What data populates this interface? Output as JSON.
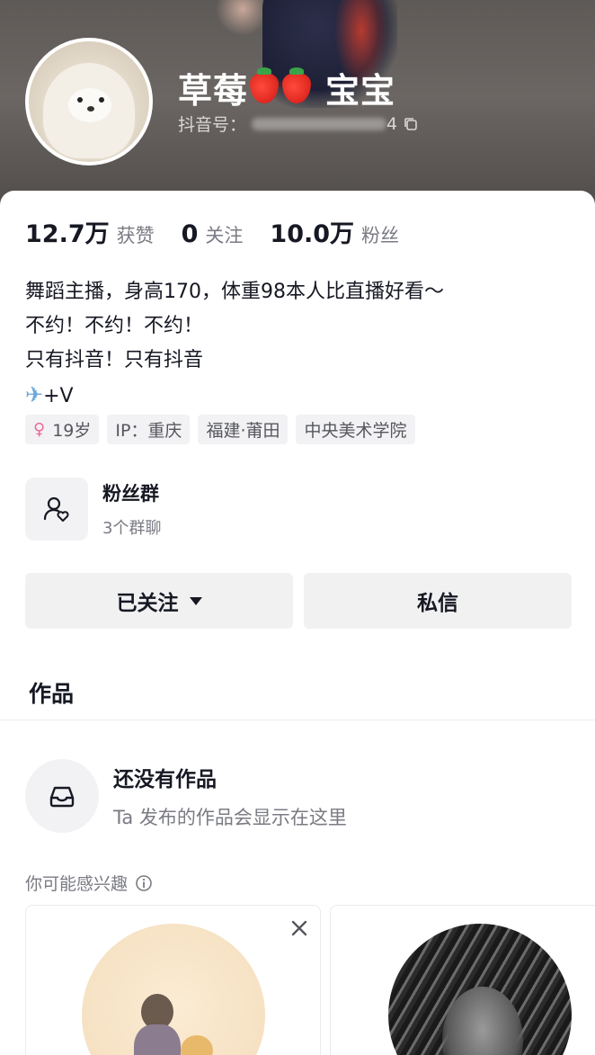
{
  "profile": {
    "nickname_start": "草莓",
    "nickname_end": "宝宝",
    "douyin_id_label": "抖音号：",
    "douyin_id_tail": "4"
  },
  "stats": [
    {
      "value": "12.7万",
      "label": "获赞"
    },
    {
      "value": "0",
      "label": "关注"
    },
    {
      "value": "10.0万",
      "label": "粉丝"
    }
  ],
  "bio": {
    "line1": "舞蹈主播，身高170，体重98本人比直播好看～",
    "line2": "不约！不约！不约！",
    "line3": "只有抖音！只有抖音",
    "line4_text": "+V"
  },
  "tags": [
    {
      "text": "19岁",
      "icon": "female-icon"
    },
    {
      "text": "IP：重庆"
    },
    {
      "text": "福建·莆田"
    },
    {
      "text": "中央美术学院"
    }
  ],
  "fans_group": {
    "title": "粉丝群",
    "subtitle": "3个群聊"
  },
  "actions": {
    "follow_label": "已关注",
    "message_label": "私信"
  },
  "works": {
    "title": "作品",
    "empty_title": "还没有作品",
    "empty_subtitle": "Ta 发布的作品会显示在这里"
  },
  "recommend": {
    "title": "你可能感兴趣"
  },
  "colors": {
    "accent_text": "#161823",
    "muted_text": "#7a7b83",
    "button_bg": "#f1f1f2",
    "female_pink": "#f0679a"
  }
}
